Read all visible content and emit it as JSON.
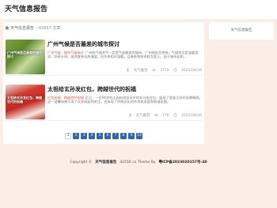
{
  "header": {
    "site_title": "天气信息报告"
  },
  "breadcrumb": {
    "home": "天气信息报告",
    "separator": "›",
    "current": "65657",
    "suffix": "文章"
  },
  "articles": [
    {
      "title": "广州气候是否最差的城市探讨",
      "thumb_text": "广州气候是否最差的城市探讨",
      "tag": "广州气候 · 城市气候探讨",
      "desc": "广州的气候并不一定是气候最差的城市。广州地处亚热带，气候特点是温暖湿润，四季分明。虽然夏季炎热潮湿，但冬季相对温暖，且春季和秋季较为宜人。由于城市化和...",
      "author": "天气推荐",
      "views": "3719",
      "date": "2025/09/26"
    },
    {
      "title": "太祖给玄孙发红包，跨越世代的祝福",
      "thumb_text": "太祖给玄孙发红包，跨越世代的祝福",
      "tag": "红包祝福 · 跨越世代祝福",
      "desc": "近日，一位96岁的太祖给其仅半岁的玄孙发红包，展现了家族之间的深厚情感。这一温馨场景引发了众多网友的关注，也体现了传统文化的传承和家庭和和谐氛围。",
      "author": "天气推荐",
      "views": "776",
      "date": "2025/09/26"
    }
  ],
  "pagination": {
    "pages": [
      "1",
      "2",
      "3",
      "4",
      "5",
      "6",
      "7",
      "8",
      "9",
      "10"
    ],
    "current": "1"
  },
  "sidebar": {
    "title": "天气信息报告"
  },
  "footer": {
    "copyright": "Copyright ©",
    "site": "天气信息报告",
    "views_note": "42550 cn Theme By",
    "icp": "粤ICP备2023020157号-40"
  }
}
